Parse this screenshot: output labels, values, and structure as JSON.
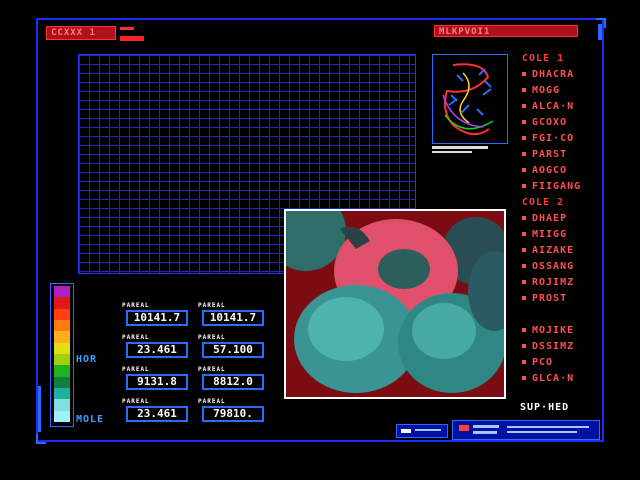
{
  "header": {
    "left_badge": "CCXXX 1",
    "right_badge": "MLKPVOI1"
  },
  "menu": {
    "section1_title": "COLE 1",
    "section1_items": [
      "DHACRA",
      "MOGG",
      "ALCA·N",
      "GCOXO",
      "FGI·CO",
      "PARST",
      "AOGCO",
      "FIIGANG"
    ],
    "section2_title": "COLE 2",
    "section2_items": [
      "DHAEP",
      "MIIGG",
      "AIZAKE",
      "OSSANG",
      "ROJIMZ",
      "PROST"
    ],
    "section3_items": [
      "MOJIKE",
      "DSSIMZ",
      "PCO",
      "GLCA·N"
    ]
  },
  "axis": {
    "upper_label": "HOR",
    "lower_label": "MOLE"
  },
  "colorbar": {
    "colors": [
      "#b020c0",
      "#e01818",
      "#ff4010",
      "#ff7a10",
      "#ffb020",
      "#e0e010",
      "#a0d010",
      "#20b020",
      "#108040",
      "#20b0a0",
      "#80e0e0",
      "#a0f0ff"
    ]
  },
  "values": {
    "row1": {
      "label_a": "PAREAL",
      "a": "10141.7",
      "label_b": "PAREAL",
      "b": "10141.7"
    },
    "row2": {
      "label_a": "PAREAL",
      "a": "23.461",
      "label_b": "PAREAL",
      "b": "57.100"
    },
    "row3": {
      "label_a": "PAREAL",
      "a": "9131.8",
      "label_b": "PAREAL",
      "b": "8812.0"
    },
    "row4": {
      "label_a": "PAREAL",
      "a": "23.461",
      "label_b": "PAREAL",
      "b": "79810."
    }
  },
  "status": {
    "label": "SUP·HED"
  }
}
